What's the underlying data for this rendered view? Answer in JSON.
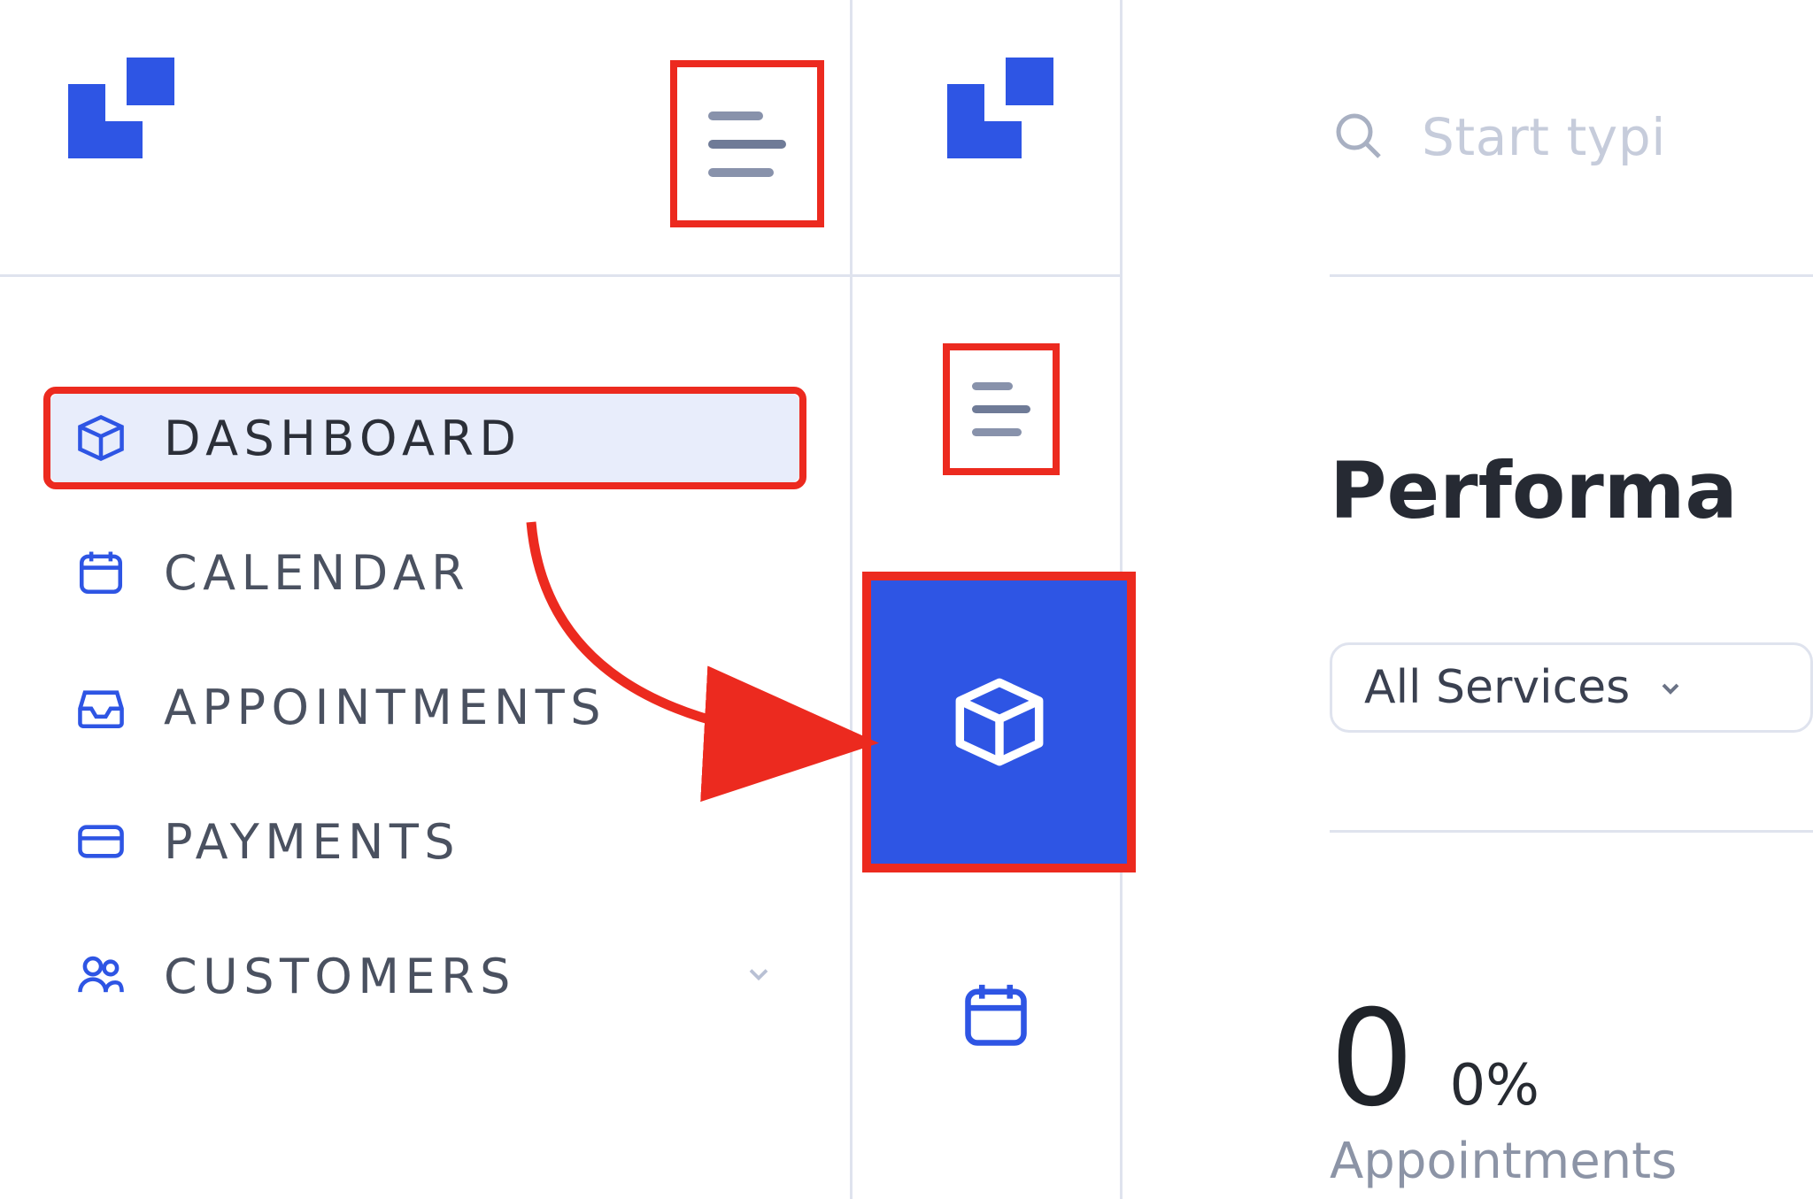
{
  "sidebar": {
    "items": [
      {
        "label": "DASHBOARD",
        "icon": "cube-icon",
        "active": true
      },
      {
        "label": "CALENDAR",
        "icon": "calendar-icon"
      },
      {
        "label": "APPOINTMENTS",
        "icon": "inbox-icon"
      },
      {
        "label": "PAYMENTS",
        "icon": "card-icon"
      },
      {
        "label": "CUSTOMERS",
        "icon": "people-icon",
        "expandable": true
      }
    ]
  },
  "search": {
    "placeholder": "Start typi"
  },
  "main": {
    "title": "Performa",
    "filter_label": "All Services",
    "kpi_value": "0",
    "kpi_pct": "0%",
    "kpi_sub": "Appointments"
  },
  "colors": {
    "accent": "#2e55e4",
    "highlight": "#ec2a1f"
  }
}
